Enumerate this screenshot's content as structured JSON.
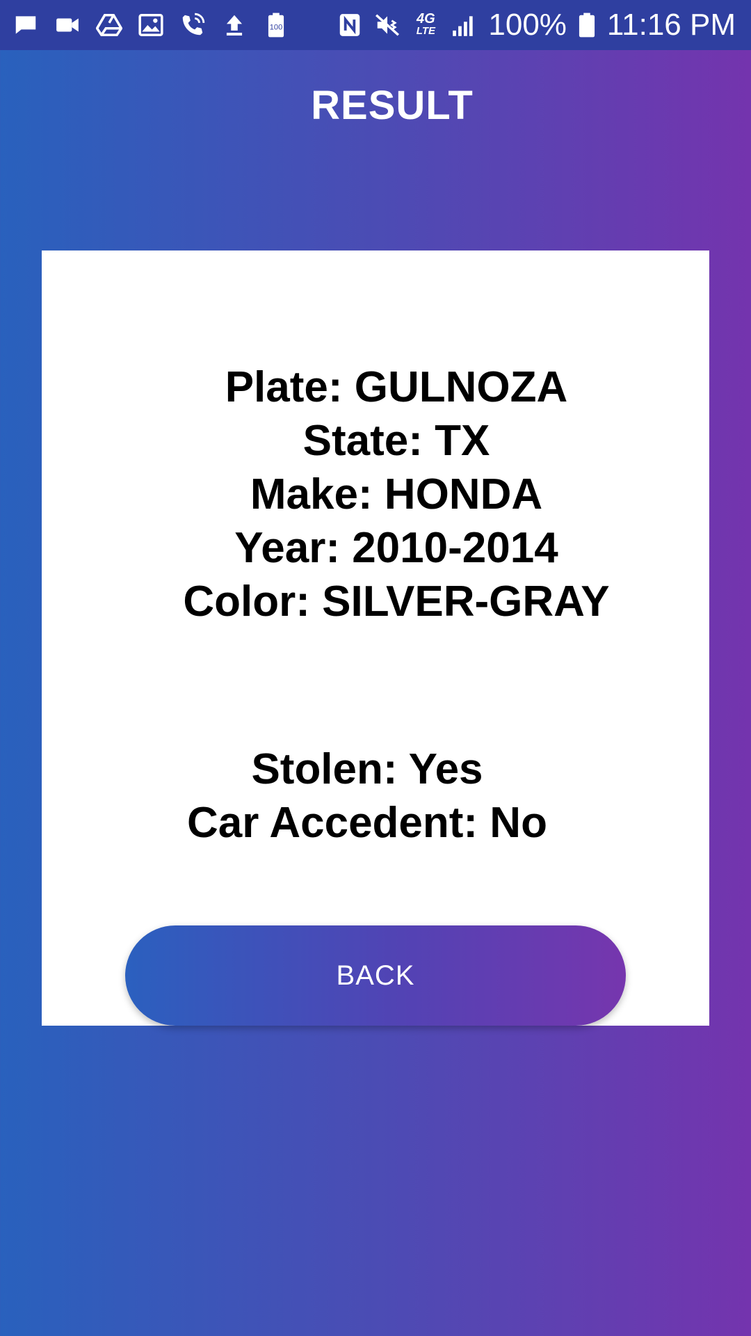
{
  "status_bar": {
    "left_icons": [
      "message-icon",
      "video-icon",
      "drive-icon",
      "image-icon",
      "wifi-call-icon",
      "upload-icon",
      "battery-100-icon"
    ],
    "battery_small_label": "100",
    "network_label_top": "4G",
    "network_label_bottom": "LTE",
    "battery_percent": "100%",
    "time": "11:16 PM",
    "right_icons": [
      "nfc-icon",
      "mute-vibrate-icon",
      "network-4g-lte-icon",
      "signal-icon",
      "battery-icon"
    ]
  },
  "header": {
    "title": "RESULT"
  },
  "result": {
    "plate": "Plate: GULNOZA",
    "state": "State: TX",
    "make": "Make: HONDA",
    "year": "Year: 2010-2014",
    "color": "Color: SILVER-GRAY",
    "stolen": "Stolen: Yes",
    "accident": "Car Accedent: No"
  },
  "actions": {
    "back_label": "BACK"
  },
  "colors": {
    "gradient_start": "#2961bd",
    "gradient_end": "#7434ae",
    "status_bar": "#2f3fa0",
    "card_background": "#ffffff",
    "text": "#000000"
  }
}
